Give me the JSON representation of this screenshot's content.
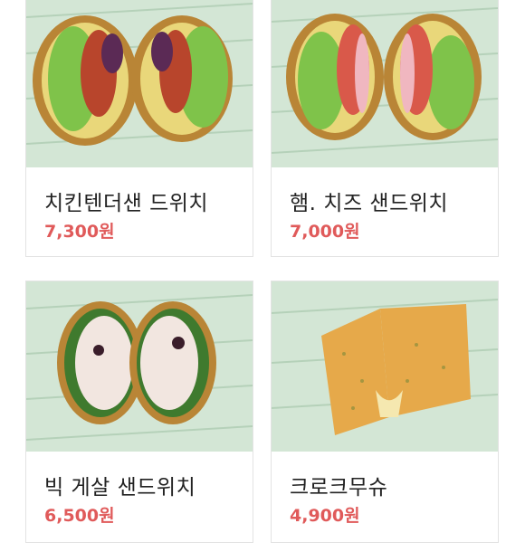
{
  "products": [
    {
      "name": "치킨텐더샌 드위치",
      "price": "7,300원"
    },
    {
      "name": "햄. 치즈 샌드위치",
      "price": "7,000원"
    },
    {
      "name": "빅 게살 샌드위치",
      "price": "6,500원"
    },
    {
      "name": "크로크무슈",
      "price": "4,900원"
    }
  ],
  "colors": {
    "price": "#e05a5a",
    "wrap_paper": "#cfe3d2",
    "bread": "#c98a3a",
    "lettuce": "#7fc34a"
  }
}
